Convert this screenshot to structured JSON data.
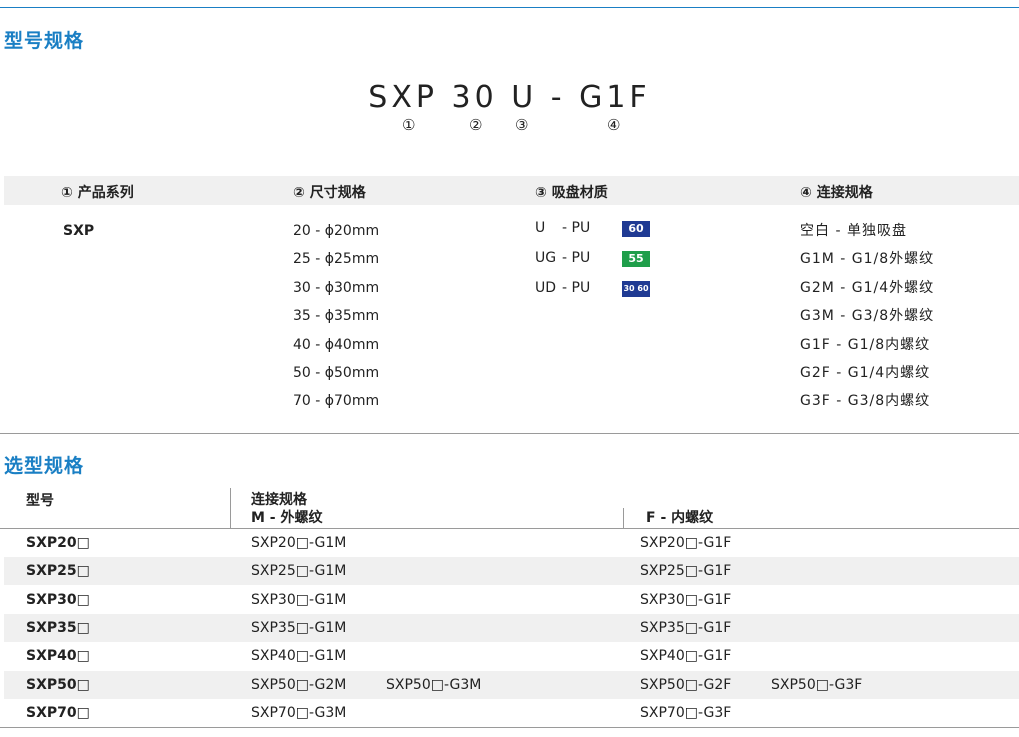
{
  "section1": {
    "title": "型号规格",
    "model_code": "SXP 30 U - G1F",
    "markers": [
      "①",
      "②",
      "③",
      "④"
    ]
  },
  "spec_table": {
    "headers": [
      "① 产品系列",
      "② 尺寸规格",
      "③ 吸盘材质",
      "④ 连接规格"
    ],
    "series": [
      "SXP"
    ],
    "sizes": [
      "20 - ϕ20mm",
      "25 - ϕ25mm",
      "30 - ϕ30mm",
      "35 - ϕ35mm",
      "40 - ϕ40mm",
      "50 - ϕ50mm",
      "70 - ϕ70mm"
    ],
    "materials": [
      {
        "code": "U",
        "sep": "- PU",
        "badge": "60",
        "color": "#1f3a93"
      },
      {
        "code": "UG",
        "sep": "- PU",
        "badge": "55",
        "color": "#1f9e4a"
      },
      {
        "code": "UD",
        "sep": "- PU",
        "badge": "30 60",
        "color": "#1f3a93"
      }
    ],
    "connections": [
      "空白 - 单独吸盘",
      "G1M - G1/8外螺纹",
      "G2M - G1/4外螺纹",
      "G3M - G3/8外螺纹",
      "G1F - G1/8内螺纹",
      "G2F - G1/4内螺纹",
      "G3F - G3/8内螺纹"
    ]
  },
  "section2": {
    "title": "选型规格",
    "header_model": "型号",
    "header_conn": "连接规格",
    "header_m": "M - 外螺纹",
    "header_f": "F - 内螺纹"
  },
  "selection_rows": [
    {
      "model": "SXP20□",
      "m": [
        "SXP20□-G1M"
      ],
      "f": [
        "SXP20□-G1F"
      ]
    },
    {
      "model": "SXP25□",
      "m": [
        "SXP25□-G1M"
      ],
      "f": [
        "SXP25□-G1F"
      ]
    },
    {
      "model": "SXP30□",
      "m": [
        "SXP30□-G1M"
      ],
      "f": [
        "SXP30□-G1F"
      ]
    },
    {
      "model": "SXP35□",
      "m": [
        "SXP35□-G1M"
      ],
      "f": [
        "SXP35□-G1F"
      ]
    },
    {
      "model": "SXP40□",
      "m": [
        "SXP40□-G1M"
      ],
      "f": [
        "SXP40□-G1F"
      ]
    },
    {
      "model": "SXP50□",
      "m": [
        "SXP50□-G2M",
        "SXP50□-G3M"
      ],
      "f": [
        "SXP50□-G2F",
        "SXP50□-G3F"
      ]
    },
    {
      "model": "SXP70□",
      "m": [
        "SXP70□-G3M"
      ],
      "f": [
        "SXP70□-G3F"
      ]
    }
  ]
}
